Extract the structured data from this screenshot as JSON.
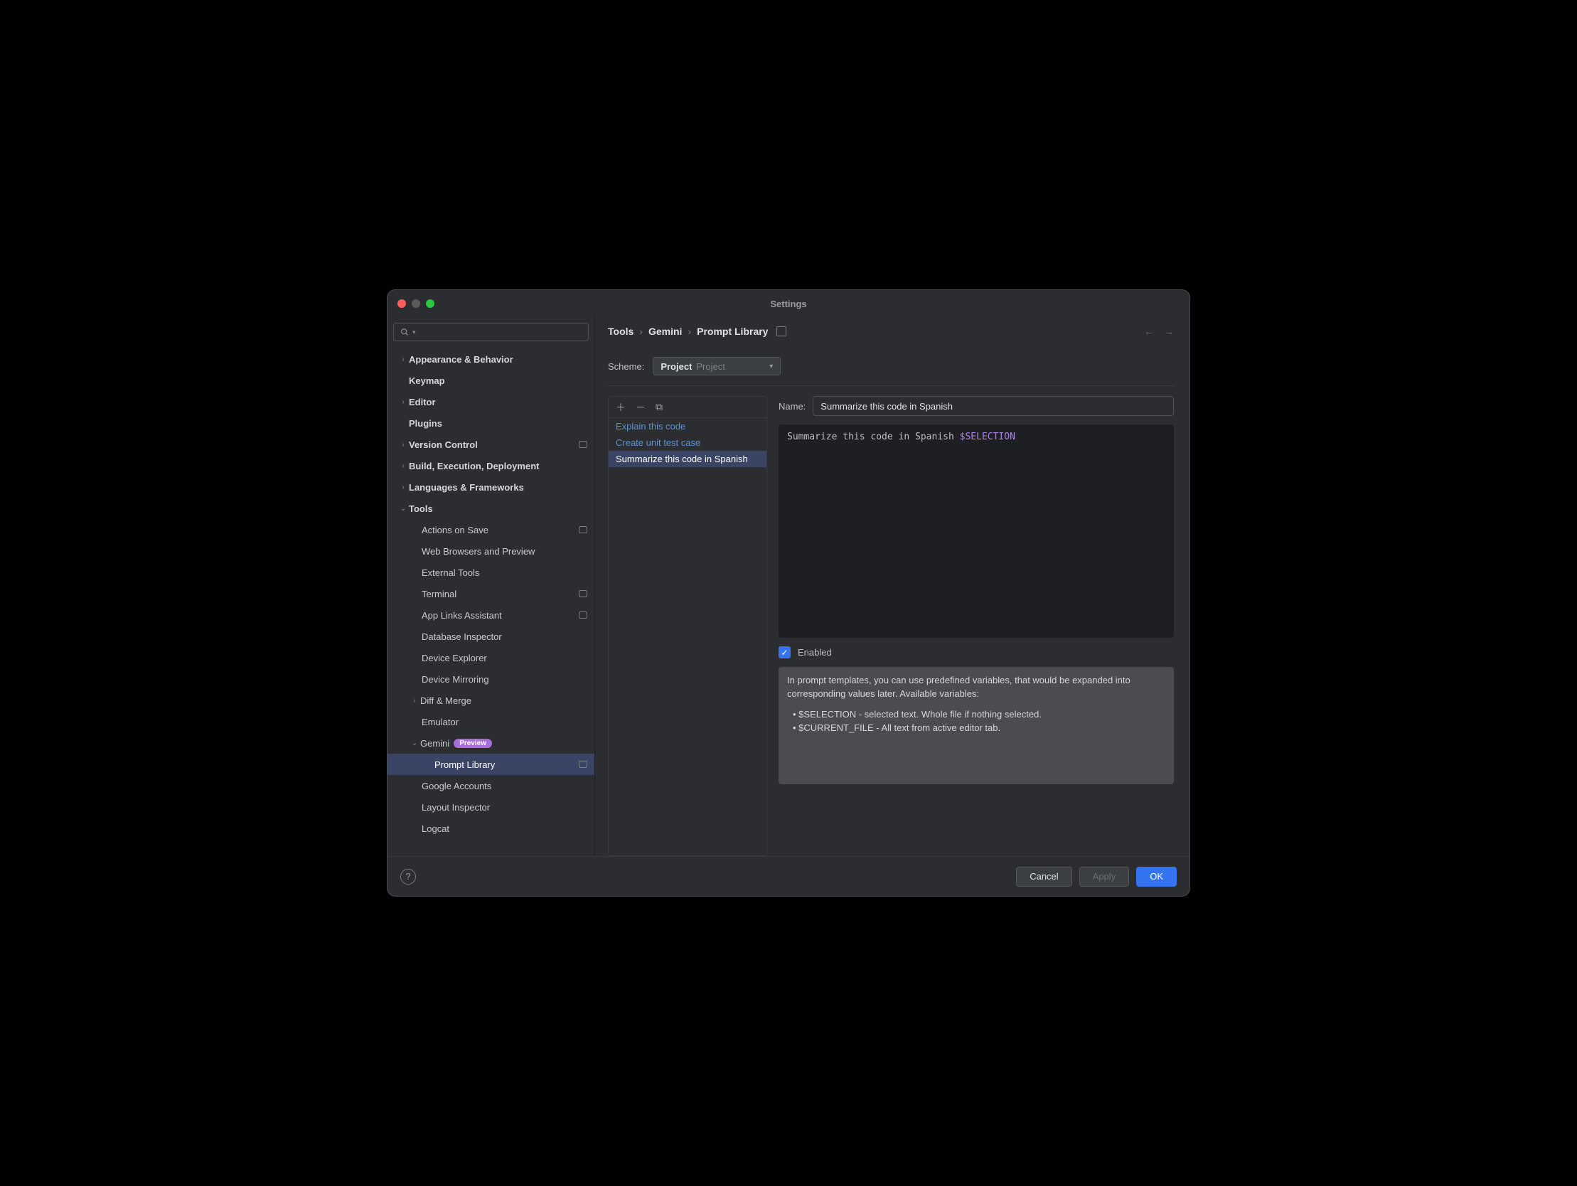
{
  "window": {
    "title": "Settings"
  },
  "breadcrumb": {
    "l1": "Tools",
    "l2": "Gemini",
    "l3": "Prompt Library"
  },
  "scheme": {
    "label": "Scheme:",
    "primary": "Project",
    "secondary": "Project"
  },
  "sidebar": {
    "items": [
      {
        "label": "Appearance & Behavior"
      },
      {
        "label": "Keymap"
      },
      {
        "label": "Editor"
      },
      {
        "label": "Plugins"
      },
      {
        "label": "Version Control"
      },
      {
        "label": "Build, Execution, Deployment"
      },
      {
        "label": "Languages & Frameworks"
      },
      {
        "label": "Tools"
      },
      {
        "label": "Actions on Save"
      },
      {
        "label": "Web Browsers and Preview"
      },
      {
        "label": "External Tools"
      },
      {
        "label": "Terminal"
      },
      {
        "label": "App Links Assistant"
      },
      {
        "label": "Database Inspector"
      },
      {
        "label": "Device Explorer"
      },
      {
        "label": "Device Mirroring"
      },
      {
        "label": "Diff & Merge"
      },
      {
        "label": "Emulator"
      },
      {
        "label": "Gemini",
        "badge": "Preview"
      },
      {
        "label": "Prompt Library"
      },
      {
        "label": "Google Accounts"
      },
      {
        "label": "Layout Inspector"
      },
      {
        "label": "Logcat"
      }
    ]
  },
  "prompts": {
    "items": [
      "Explain this code",
      "Create unit test case",
      "Summarize this code in Spanish"
    ]
  },
  "detail": {
    "nameLabel": "Name:",
    "nameValue": "Summarize this code in Spanish",
    "editorPrefix": "Summarize this code in Spanish ",
    "editorVar": "$SELECTION",
    "enabledLabel": "Enabled",
    "helpLine1": "In prompt templates, you can use predefined variables, that would be expanded into corresponding values later. Available variables:",
    "helpBullet1": "• $SELECTION - selected text. Whole file if nothing selected.",
    "helpBullet2": "• $CURRENT_FILE - All text from active editor tab."
  },
  "footer": {
    "cancel": "Cancel",
    "apply": "Apply",
    "ok": "OK"
  }
}
